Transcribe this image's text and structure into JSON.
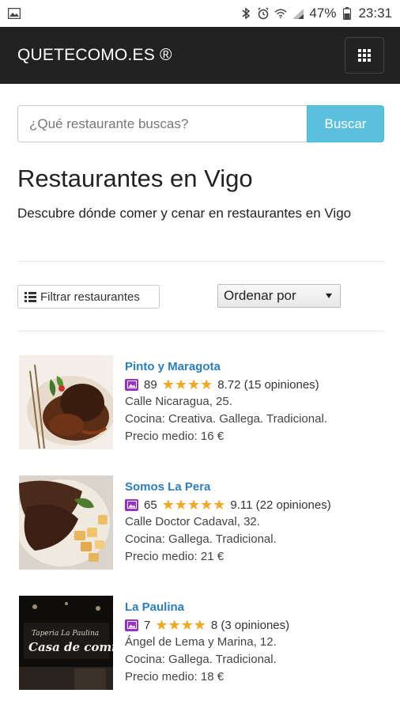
{
  "status_bar": {
    "battery": "47%",
    "time": "23:31"
  },
  "navbar": {
    "brand": "QUETECOMO.ES ®"
  },
  "search": {
    "placeholder": "¿Qué restaurante buscas?",
    "button_label": "Buscar"
  },
  "page": {
    "title": "Restaurantes en Vigo",
    "subtitle": "Descubre dónde comer y cenar en restaurantes en Vigo"
  },
  "toolbar": {
    "filter_label": "Filtrar restaurantes",
    "sort_label": "Ordenar por"
  },
  "restaurants": [
    {
      "name": "Pinto y Maragota",
      "photos": "89",
      "stars": "★★★★",
      "score": "8.72",
      "reviews": "(15 opiniones)",
      "address": "Calle Nicaragua, 25.",
      "cuisine": "Cocina: Creativa. Gallega. Tradicional.",
      "price": "Precio medio: 16 €"
    },
    {
      "name": "Somos La Pera",
      "photos": "65",
      "stars": "★★★★★",
      "score": "9.11",
      "reviews": "(22 opiniones)",
      "address": "Calle Doctor Cadaval, 32.",
      "cuisine": "Cocina: Gallega. Tradicional.",
      "price": "Precio medio: 21 €"
    },
    {
      "name": "La Paulina",
      "photos": "7",
      "stars": "★★★★",
      "score": "8",
      "reviews": "(3 opiniones)",
      "address": "Ángel de Lema y Marina, 12.",
      "cuisine": "Cocina: Gallega. Tradicional.",
      "price": "Precio medio: 18 €",
      "photo_sign_line1": "Taperia La Paulina",
      "photo_sign_line2": "Casa de comidas"
    }
  ],
  "colors": {
    "navbar_bg": "#222222",
    "search_button": "#5bc0de",
    "link": "#2a7fc1",
    "star": "#f5a623",
    "photo_icon": "#9b30c6"
  }
}
